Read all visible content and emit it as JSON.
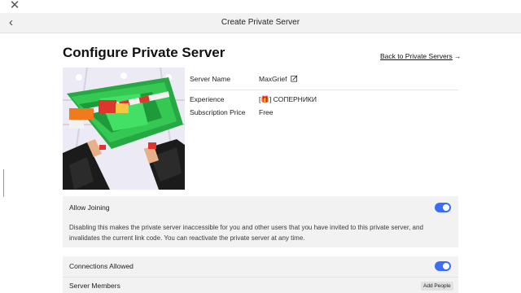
{
  "window": {
    "close_icon": "close-icon"
  },
  "header": {
    "title": "Create Private Server",
    "back_icon": "chevron-left-icon"
  },
  "page": {
    "title": "Configure Private Server",
    "back_link": "Back to Private Servers",
    "back_link_icon": "arrow-right-icon"
  },
  "details": {
    "server_name_label": "Server Name",
    "server_name_value": "MaxGrief",
    "edit_icon": "edit-icon",
    "experience_label": "Experience",
    "experience_value": "[🎁] СОПЕРНИКИ",
    "subscription_label": "Subscription Price",
    "subscription_value": "Free"
  },
  "allow_joining": {
    "label": "Allow Joining",
    "enabled": true,
    "description": "Disabling this makes the private server inaccessible for you and other users that you have invited to this private server, and invalidates the current link code. You can reactivate the private server at any time."
  },
  "connections": {
    "label": "Connections Allowed",
    "enabled": true,
    "members_label": "Server Members",
    "add_people_label": "Add People"
  },
  "colors": {
    "accent": "#3b6ef5",
    "panel_bg": "#f2f2f3",
    "header_bg": "#f2f2f3"
  }
}
